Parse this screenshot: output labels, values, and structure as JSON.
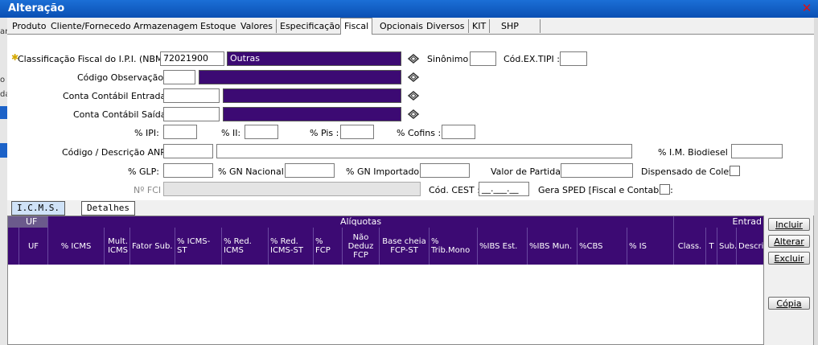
{
  "window": {
    "title": "Alteração"
  },
  "tabs": [
    "Produto",
    "Cliente/Fornecedor",
    "Armazenagem",
    "Estoque",
    "Valores",
    "Especificação",
    "Fiscal",
    "Opcionais",
    "Diversos",
    "KIT",
    "SHP"
  ],
  "form": {
    "ncm_label": "Classificação Fiscal do I.P.I. (NBM) :",
    "ncm_value": "72021900",
    "ncm_desc": "Outras",
    "sinonimo_label": "Sinônimo :",
    "cod_ex_tipi_label": "Cód.EX.TIPI :",
    "cod_obs_label": "Código Observação :",
    "conta_entrada_label": "Conta Contábil Entrada :",
    "conta_saida_label": "Conta Contábil Saída :",
    "ipi_label": "% IPI:",
    "ii_label": "% II:",
    "pis_label": "% Pis :",
    "cofins_label": "% Cofins :",
    "anp_label": "Código / Descrição ANP :",
    "biodiesel_label": "% I.M. Biodiesel :",
    "glp_label": "% GLP:",
    "gn_nacional_label": "% GN Nacional:",
    "gn_importado_label": "% GN Importado:",
    "valor_partida_label": "Valor de Partida:",
    "dispensado_label": "Dispensado de Coleta",
    "nfci_label": "Nº FCI :",
    "cest_label": "Cód. CEST :",
    "cest_value": "__.___.__",
    "sped_label": "Gera SPED [Fiscal e Contabil] :"
  },
  "subtabs": [
    "I.C.M.S.",
    "Detalhes"
  ],
  "grid": {
    "groups": [
      "UF",
      "Alíquotas",
      "Entrad"
    ],
    "columns": [
      "UF",
      "% ICMS",
      "Mult. ICMS",
      "Fator Sub.",
      "% ICMS-ST",
      "% Red. ICMS",
      "% Red. ICMS-ST",
      "% FCP",
      "Não Deduz FCP",
      "Base cheia FCP-ST",
      "% Trib.Mono",
      "%IBS Est.",
      "%IBS Mun.",
      "%CBS",
      "% IS",
      "Class.",
      "T",
      "Sub.",
      "Descri"
    ]
  },
  "buttons": {
    "incluir": "Incluir",
    "alterar": "Alterar",
    "excluir": "Excluir",
    "copia": "Cópia"
  },
  "left_fragments": [
    "o:",
    "ar",
    "o",
    "da"
  ]
}
